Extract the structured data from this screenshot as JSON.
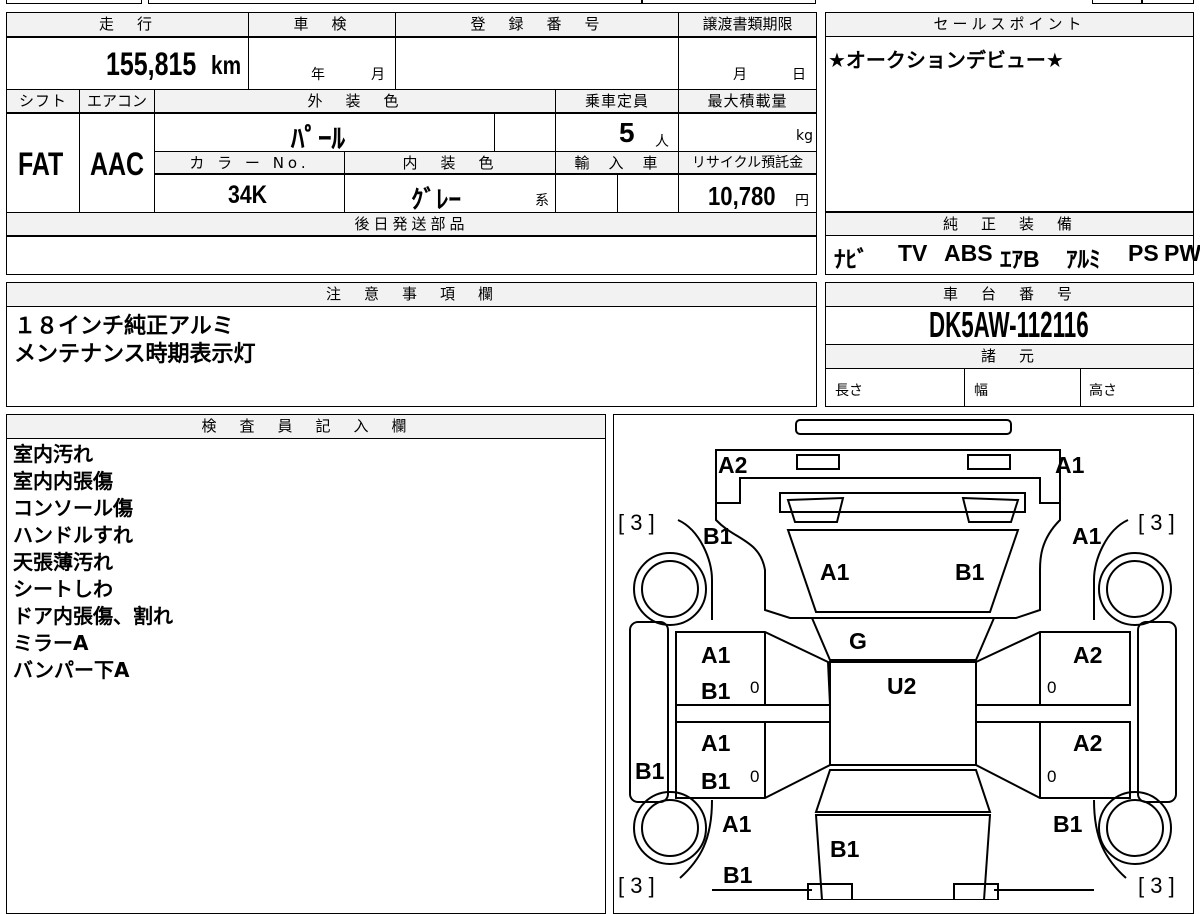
{
  "headers": {
    "mileage": "走　行",
    "inspection": "車　検",
    "registration": "登　録　番　号",
    "transfer_deadline": "譲渡書類期限",
    "sales_point": "セールスポイント",
    "shift": "シフト",
    "aircon": "エアコン",
    "exterior_color": "外　装　色",
    "capacity": "乗車定員",
    "max_load": "最大積載量",
    "color_no": "カ ラ ー No.",
    "interior_color": "内　装　色",
    "import": "輸　入　車",
    "recycle": "リサイクル預託金",
    "later_parts": "後日発送部品",
    "equipment": "純　正　装　備",
    "notes": "注　意　事　項　欄",
    "chassis": "車　台　番　号",
    "specs": "諸　元",
    "inspector": "検　査　員　記　入　欄"
  },
  "values": {
    "mileage": "155,815",
    "mileage_unit": "km",
    "year_unit": "年",
    "month_unit": "月",
    "deadline_month": "月",
    "deadline_day": "日",
    "sales_point": "★オークションデビュー★",
    "shift": "FAT",
    "aircon": "AAC",
    "exterior_color": "ﾊﾟｰﾙ",
    "capacity": "5",
    "capacity_unit": "人",
    "max_load_unit": "kg",
    "color_no": "34K",
    "interior_color": "ｸﾞﾚｰ",
    "interior_suffix": "系",
    "recycle": "10,780",
    "recycle_unit": "円",
    "equipment": [
      "ﾅﾋﾞ",
      "TV",
      "ABS",
      "ｴｱB",
      "ｱﾙﾐ",
      "PS",
      "PW"
    ],
    "notes": [
      "１８インチ純正アルミ",
      "メンテナンス時期表示灯"
    ],
    "chassis": "DK5AW-112116",
    "length": "長さ",
    "width": "幅",
    "height": "高さ",
    "inspector_notes": [
      "室内汚れ",
      "室内内張傷",
      "コンソール傷",
      "ハンドルすれ",
      "天張薄汚れ",
      "シートしわ",
      "ドア内張傷、割れ",
      "ミラーA",
      "バンパー下A"
    ]
  },
  "diagram": {
    "tire_depth": "[ 3 ]",
    "tire_zero": "0",
    "codes": {
      "front_left_corner": "A2",
      "front_right_corner": "A1",
      "front_left_fender": "B1",
      "front_right_fender": "A1",
      "hood_left": "A1",
      "hood_right": "B1",
      "windshield": "G",
      "roof": "U2",
      "front_left_door_1": "A1",
      "front_left_door_2": "B1",
      "front_right_door": "A2",
      "rear_left_door_1": "A1",
      "rear_left_door_2": "B1",
      "rear_right_door": "A2",
      "left_rocker": "B1",
      "rear_left_quarter": "A1",
      "rear_right_quarter": "B1",
      "rear_left_lower": "B1",
      "tailgate": "B1"
    }
  }
}
